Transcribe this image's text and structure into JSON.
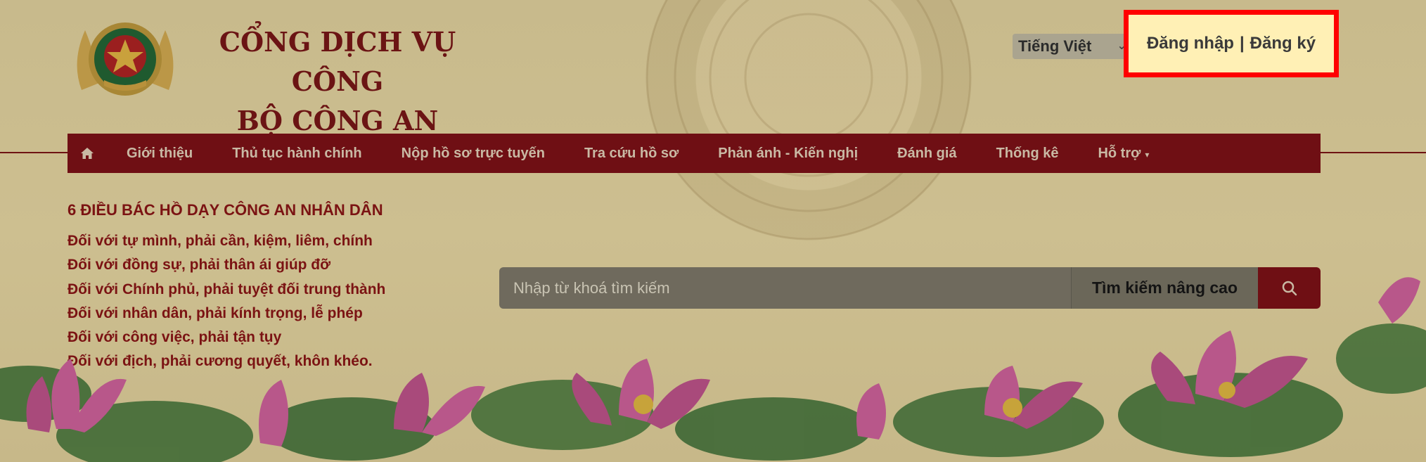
{
  "header": {
    "title_line1": "CỔNG DỊCH VỤ CÔNG",
    "title_line2": "BỘ CÔNG AN",
    "language": "Tiếng Việt",
    "login_label": "Đăng nhập",
    "separator": "|",
    "register_label": "Đăng ký"
  },
  "nav": {
    "items": [
      {
        "label": "Giới thiệu"
      },
      {
        "label": "Thủ tục hành chính"
      },
      {
        "label": "Nộp hồ sơ trực tuyến"
      },
      {
        "label": "Tra cứu hồ sơ"
      },
      {
        "label": "Phản ánh - Kiến nghị"
      },
      {
        "label": "Đánh giá"
      },
      {
        "label": "Thống kê"
      },
      {
        "label": "Hỗ trợ"
      }
    ],
    "home_icon": "home-icon",
    "dropdown_icon": "caret-down-icon"
  },
  "teachings": {
    "title": "6 ĐIỀU BÁC HỒ DẠY CÔNG AN NHÂN DÂN",
    "items": [
      "Đối với tự mình, phải cần, kiệm, liêm, chính",
      "Đối với đồng sự, phải thân ái giúp đỡ",
      "Đối với Chính phủ, phải tuyệt đối trung thành",
      "Đối với nhân dân, phải kính trọng, lễ phép",
      "Đối với công việc, phải tận tụy",
      "Đối với địch, phải cương quyết, khôn khéo."
    ]
  },
  "search": {
    "placeholder": "Nhập từ khoá tìm kiếm",
    "advanced_label": "Tìm kiếm nâng cao",
    "icon": "search-icon"
  },
  "colors": {
    "brand_red": "#6f0f14",
    "title_red": "#6b1414",
    "highlight_border": "#ff0000",
    "highlight_fill": "#fff0b5"
  }
}
